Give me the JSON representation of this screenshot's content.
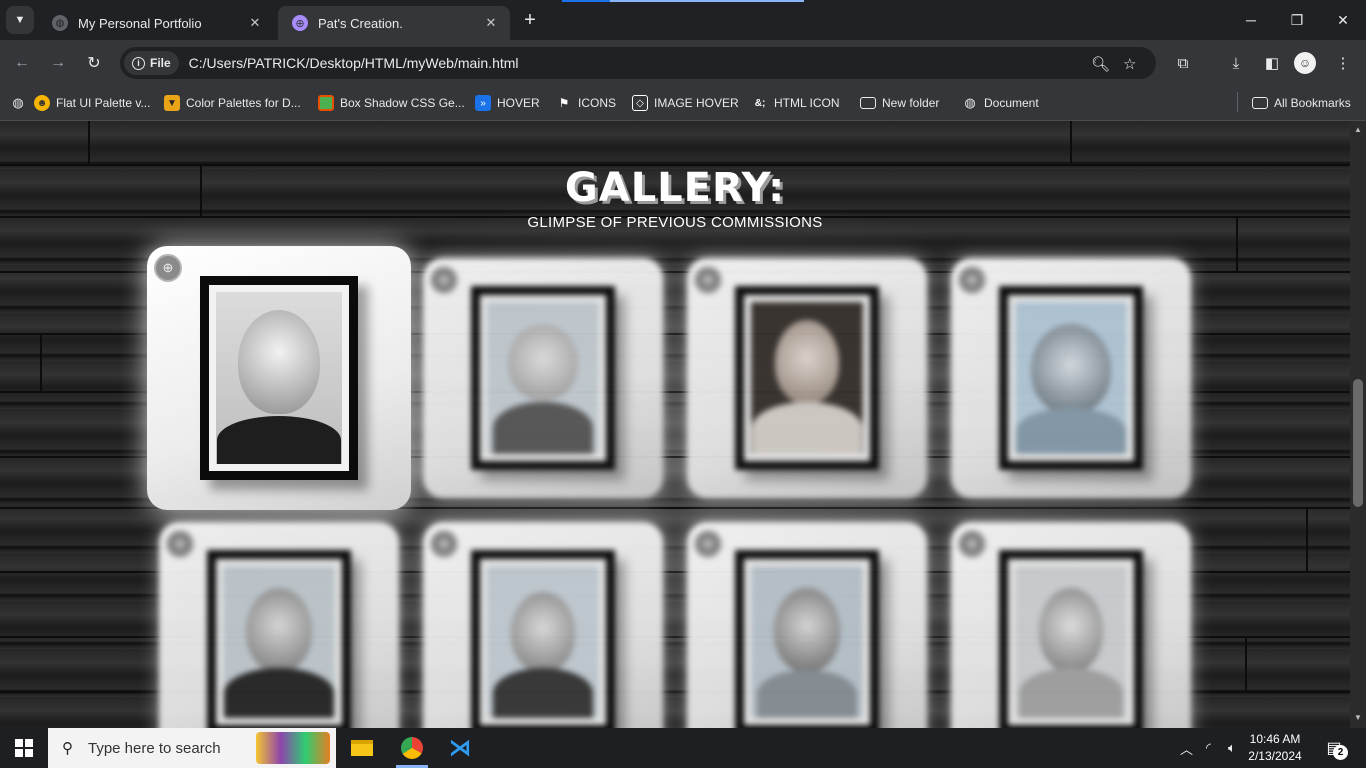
{
  "browser": {
    "tabs": [
      {
        "title": "My Personal Portfolio",
        "active": false
      },
      {
        "title": "Pat's Creation.",
        "active": true
      }
    ],
    "address": {
      "chip_label": "File",
      "url": "C:/Users/PATRICK/Desktop/HTML/myWeb/main.html"
    },
    "bookmarks": [
      {
        "label": "Flat UI Palette v...",
        "icon": "emoji-icon",
        "color": "#f4b400"
      },
      {
        "label": "Color Palettes for D...",
        "icon": "palette-icon",
        "color": "#e8a317"
      },
      {
        "label": "Box Shadow CSS Ge...",
        "icon": "box-icon",
        "color": "#4caf50"
      },
      {
        "label": "HOVER",
        "icon": "hover-icon",
        "color": "#1a73e8"
      },
      {
        "label": "ICONS",
        "icon": "flag-icon",
        "color": "#ffffff"
      },
      {
        "label": "IMAGE HOVER",
        "icon": "codepen-icon",
        "color": "#ffffff"
      },
      {
        "label": "HTML ICON",
        "icon": "ampersand-icon",
        "color": "#ffffff"
      },
      {
        "label": "New folder",
        "icon": "folder-icon",
        "color": "#e8eaed"
      },
      {
        "label": "Document",
        "icon": "globe-icon",
        "color": "#e8eaed"
      }
    ],
    "all_bookmarks_label": "All Bookmarks"
  },
  "page": {
    "title": "GALLERY:",
    "subtitle": "GLIMPSE OF PREVIOUS COMMISSIONS",
    "gallery": [
      {
        "subject": "elderly-man-portrait",
        "state": "focused"
      },
      {
        "subject": "child-with-pigtails-portrait",
        "state": "blurred"
      },
      {
        "subject": "woman-with-headscarf-portrait",
        "state": "blurred"
      },
      {
        "subject": "mother-and-child-portrait",
        "state": "blurred"
      },
      {
        "subject": "smiling-woman-portrait",
        "state": "blurred"
      },
      {
        "subject": "graduate-with-cap-portrait",
        "state": "blurred"
      },
      {
        "subject": "woman-hand-on-chin-portrait",
        "state": "blurred"
      },
      {
        "subject": "long-haired-woman-portrait",
        "state": "blurred"
      }
    ]
  },
  "taskbar": {
    "search_placeholder": "Type here to search",
    "time": "10:46 AM",
    "date": "2/13/2024",
    "notification_count": "2"
  },
  "colors": {
    "browser_dark": "#202124",
    "browser_toolbar": "#35363a",
    "progress_blue": "#1a73e8",
    "card_white": "#ffffff"
  }
}
